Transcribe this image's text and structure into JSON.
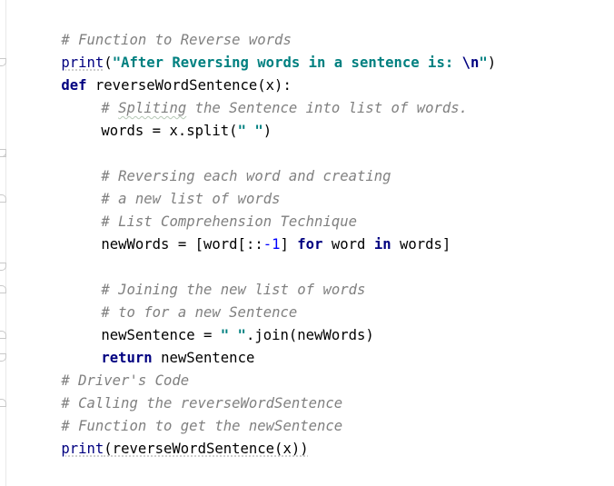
{
  "editor": {
    "lines": [
      {
        "comment": "# Function to Reverse words"
      },
      {
        "fn": "print",
        "open": "(",
        "str": "\"After Reversing words in a sentence is: ",
        "esc": "\\n",
        "strEnd": "\"",
        "close": ")"
      },
      {
        "kw": "def",
        "rest": " reverseWordSentence(x):"
      },
      {
        "comment_a": "# ",
        "comment_b": "Spliting",
        "comment_c": " the Sentence into list of words."
      },
      {
        "pre": "words = x.split(",
        "str": "\" \"",
        "post": ")"
      },
      {
        "blank": ""
      },
      {
        "comment": "# Reversing each word and creating"
      },
      {
        "comment": "# a new list of words"
      },
      {
        "comment": "# List Comprehension Technique"
      },
      {
        "a": "newWords = [word[::",
        "num": "-1",
        "b": "] ",
        "kw1": "for",
        "c": " word ",
        "kw2": "in",
        "d": " words]"
      },
      {
        "blank": ""
      },
      {
        "comment": "# Joining the new list of words"
      },
      {
        "comment": "# to for a new Sentence"
      },
      {
        "a": "newSentence = ",
        "str": "\" \"",
        "b": ".join(newWords)"
      },
      {
        "kw": "return",
        "rest": " newSentence"
      },
      {
        "comment": "# Driver's Code"
      },
      {
        "comment": "# Calling the reverseWordSentence"
      },
      {
        "comment": "# Function to get the newSentence"
      },
      {
        "fn": "print",
        "rest": "(reverseWordSentence(x))"
      }
    ]
  }
}
